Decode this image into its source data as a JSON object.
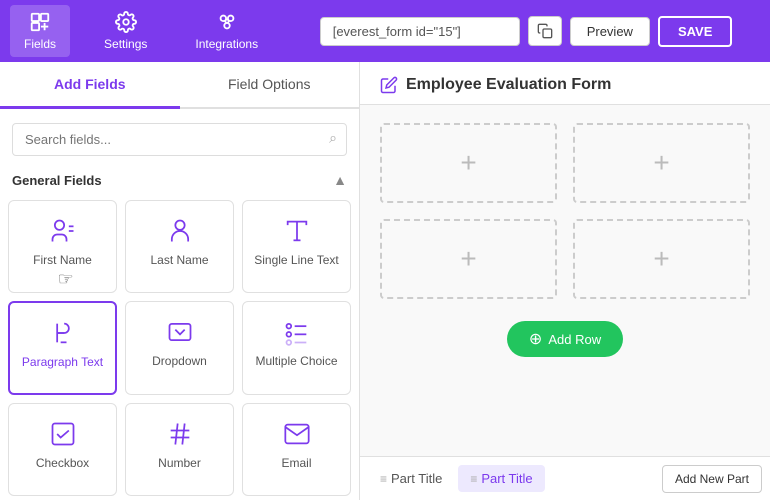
{
  "nav": {
    "items": [
      {
        "id": "fields",
        "label": "Fields",
        "active": true
      },
      {
        "id": "settings",
        "label": "Settings",
        "active": false
      },
      {
        "id": "integrations",
        "label": "Integrations",
        "active": false
      }
    ],
    "shortcode": "[everest_form id=\"15\"]",
    "preview_label": "Preview",
    "save_label": "SAVE"
  },
  "left_panel": {
    "tabs": [
      {
        "id": "add-fields",
        "label": "Add Fields",
        "active": true
      },
      {
        "id": "field-options",
        "label": "Field Options",
        "active": false
      }
    ],
    "search_placeholder": "Search fields...",
    "section_label": "General Fields",
    "fields": [
      {
        "id": "first-name",
        "label": "First Name",
        "icon": "person-text"
      },
      {
        "id": "last-name",
        "label": "Last Name",
        "icon": "person"
      },
      {
        "id": "single-line-text",
        "label": "Single Line Text",
        "icon": "text-t"
      },
      {
        "id": "paragraph-text",
        "label": "Paragraph Text",
        "icon": "paragraph",
        "selected": true
      },
      {
        "id": "dropdown",
        "label": "Dropdown",
        "icon": "dropdown"
      },
      {
        "id": "multiple-choice",
        "label": "Multiple Choice",
        "icon": "radio"
      },
      {
        "id": "checkbox",
        "label": "Checkbox",
        "icon": "checkbox"
      },
      {
        "id": "number",
        "label": "Number",
        "icon": "hash"
      },
      {
        "id": "email",
        "label": "Email",
        "icon": "email"
      }
    ]
  },
  "right_panel": {
    "form_title": "Employee Evaluation Form",
    "add_row_label": "Add Row",
    "rows": [
      {
        "cells": 2
      },
      {
        "cells": 2
      }
    ],
    "part_titles": [
      {
        "label": "Part Title",
        "active": false
      },
      {
        "label": "Part Title",
        "active": true
      }
    ],
    "add_part_label": "Add New Part"
  }
}
